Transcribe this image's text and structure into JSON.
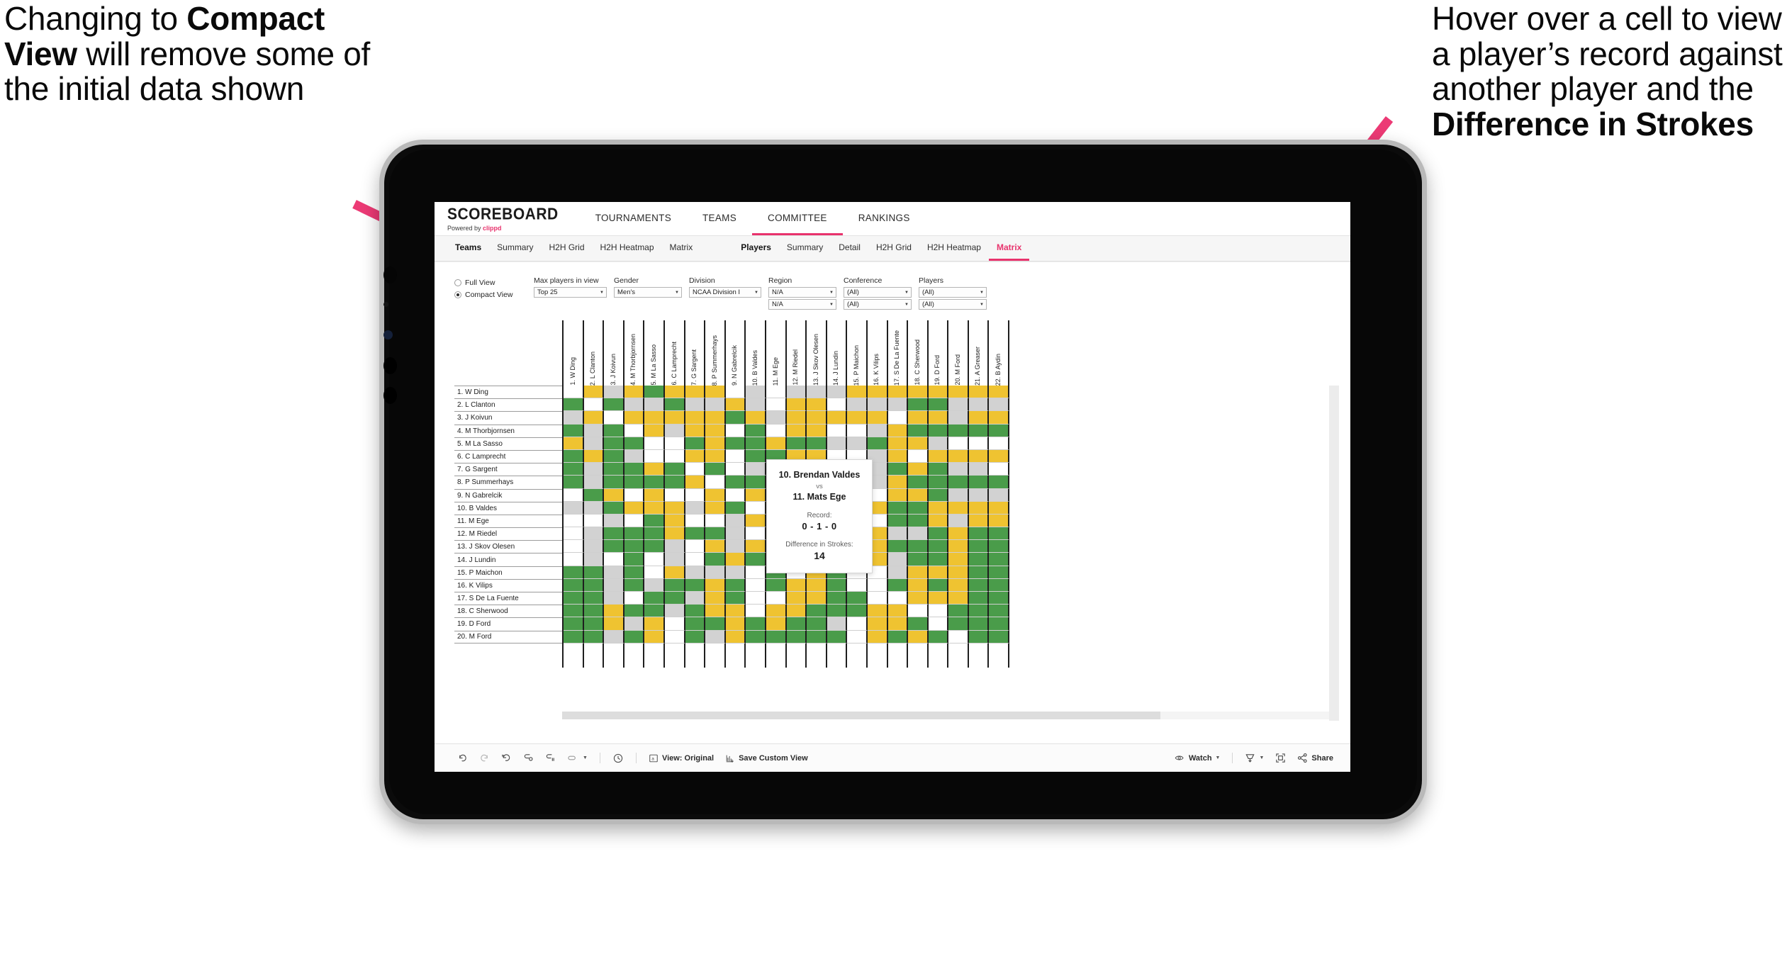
{
  "annotations": {
    "left": {
      "line1": "Changing to ",
      "bold1": "Compact View",
      "line2": " will remove some of the initial data shown"
    },
    "right": {
      "line1": "Hover over a cell to view a player’s record against another player and the ",
      "bold1": "Difference in Strokes"
    },
    "arrow_color": "#ec3a75"
  },
  "app": {
    "brand": {
      "name": "SCOREBOARD",
      "powered_prefix": "Powered by ",
      "powered_brand": "clippd"
    },
    "top_nav": [
      {
        "label": "TOURNAMENTS",
        "active": false
      },
      {
        "label": "TEAMS",
        "active": false
      },
      {
        "label": "COMMITTEE",
        "active": true
      },
      {
        "label": "RANKINGS",
        "active": false
      }
    ],
    "sub_tabs_teams": [
      {
        "label": "Teams",
        "group": true
      },
      {
        "label": "Summary",
        "active": false
      },
      {
        "label": "H2H Grid",
        "active": false
      },
      {
        "label": "H2H Heatmap",
        "active": false
      },
      {
        "label": "Matrix",
        "active": false
      }
    ],
    "sub_tabs_players": [
      {
        "label": "Players",
        "group": true
      },
      {
        "label": "Summary",
        "active": false
      },
      {
        "label": "Detail",
        "active": false
      },
      {
        "label": "H2H Grid",
        "active": false
      },
      {
        "label": "H2H Heatmap",
        "active": false
      },
      {
        "label": "Matrix",
        "active": true
      }
    ]
  },
  "filters": {
    "view_mode": {
      "options": [
        "Full View",
        "Compact View"
      ],
      "selected": "Compact View"
    },
    "selects": [
      {
        "label": "Max players in view",
        "value": "Top 25",
        "width_class": "w-mx"
      },
      {
        "label": "Gender",
        "value": "Men's",
        "width_class": "w-gd"
      },
      {
        "label": "Division",
        "value": "NCAA Division I",
        "width_class": "w-dv"
      },
      {
        "label": "Region",
        "value": "N/A",
        "value2": "N/A",
        "width_class": "w-rg"
      },
      {
        "label": "Conference",
        "value": "(All)",
        "value2": "(All)",
        "width_class": "w-cf"
      },
      {
        "label": "Players",
        "value": "(All)",
        "value2": "(All)",
        "width_class": "w-pl"
      }
    ]
  },
  "matrix": {
    "row_labels": [
      "1. W Ding",
      "2. L Clanton",
      "3. J Koivun",
      "4. M Thorbjornsen",
      "5. M La Sasso",
      "6. C Lamprecht",
      "7. G Sargent",
      "8. P Summerhays",
      "9. N Gabrelcik",
      "10. B Valdes",
      "11. M Ege",
      "12. M Riedel",
      "13. J Skov Olesen",
      "14. J Lundin",
      "15. P Maichon",
      "16. K Vilips",
      "17. S De La Fuente",
      "18. C Sherwood",
      "19. D Ford",
      "20. M Ford"
    ],
    "col_labels": [
      "1. W Ding",
      "2. L Clanton",
      "3. J Koivun",
      "4. M Thorbjornsen",
      "5. M La Sasso",
      "6. C Lamprecht",
      "7. G Sargent",
      "8. P Summerhays",
      "9. N Gabrelcik",
      "10. B Valdes",
      "11. M Ege",
      "12. M Riedel",
      "13. J Skov Olesen",
      "14. J Lundin",
      "15. P Maichon",
      "16. K Vilips",
      "17. S De La Fuente",
      "18. C Sherwood",
      "19. D Ford",
      "20. M Ford",
      "21. A Greaser",
      "22. B Aydin"
    ],
    "legend_colors": {
      "win": "#4a9c4a",
      "loss": "#efc331",
      "tie": "#d2d2d2",
      "none": "#ffffff"
    },
    "cells": [
      [
        "w",
        "y",
        "s",
        "y",
        "g",
        "y",
        "y",
        "y",
        "w",
        "s",
        "w",
        "s",
        "s",
        "s",
        "y",
        "y",
        "y",
        "y",
        "y",
        "y",
        "y",
        "y"
      ],
      [
        "g",
        "w",
        "g",
        "s",
        "s",
        "g",
        "s",
        "s",
        "y",
        "s",
        "w",
        "y",
        "y",
        "w",
        "s",
        "s",
        "s",
        "g",
        "g",
        "s",
        "s",
        "s"
      ],
      [
        "s",
        "y",
        "w",
        "y",
        "y",
        "y",
        "y",
        "y",
        "g",
        "y",
        "s",
        "y",
        "y",
        "y",
        "y",
        "y",
        "w",
        "y",
        "y",
        "s",
        "y",
        "y"
      ],
      [
        "g",
        "s",
        "g",
        "w",
        "y",
        "s",
        "y",
        "y",
        "w",
        "g",
        "w",
        "y",
        "y",
        "w",
        "w",
        "s",
        "y",
        "g",
        "g",
        "g",
        "g",
        "g"
      ],
      [
        "y",
        "s",
        "g",
        "g",
        "w",
        "w",
        "g",
        "y",
        "g",
        "g",
        "y",
        "g",
        "g",
        "s",
        "s",
        "g",
        "y",
        "y",
        "s",
        "w",
        "w",
        "w"
      ],
      [
        "g",
        "y",
        "g",
        "s",
        "w",
        "w",
        "y",
        "y",
        "w",
        "g",
        "g",
        "y",
        "y",
        "w",
        "w",
        "s",
        "y",
        "w",
        "y",
        "y",
        "y",
        "y"
      ],
      [
        "g",
        "s",
        "g",
        "g",
        "y",
        "g",
        "w",
        "g",
        "w",
        "s",
        "w",
        "y",
        "y",
        "g",
        "y",
        "s",
        "g",
        "y",
        "g",
        "s",
        "s",
        "w"
      ],
      [
        "g",
        "s",
        "g",
        "g",
        "g",
        "g",
        "y",
        "w",
        "g",
        "g",
        "w",
        "s",
        "s",
        "s",
        "g",
        "s",
        "y",
        "g",
        "g",
        "g",
        "g",
        "g"
      ],
      [
        "w",
        "g",
        "y",
        "w",
        "y",
        "w",
        "w",
        "y",
        "w",
        "y",
        "s",
        "w",
        "g",
        "y",
        "w",
        "w",
        "y",
        "y",
        "g",
        "s",
        "s",
        "s"
      ],
      [
        "s",
        "s",
        "g",
        "y",
        "y",
        "y",
        "s",
        "y",
        "g",
        "w",
        "g",
        "s",
        "y",
        "y",
        "s",
        "y",
        "g",
        "g",
        "y",
        "y",
        "y",
        "y"
      ],
      [
        "w",
        "w",
        "s",
        "w",
        "g",
        "y",
        "w",
        "w",
        "s",
        "y",
        "w",
        "s",
        "y",
        "s",
        "w",
        "w",
        "g",
        "g",
        "y",
        "s",
        "y",
        "y"
      ],
      [
        "w",
        "s",
        "g",
        "g",
        "g",
        "y",
        "g",
        "g",
        "s",
        "w",
        "s",
        "w",
        "g",
        "g",
        "g",
        "y",
        "s",
        "s",
        "g",
        "y",
        "g",
        "g"
      ],
      [
        "w",
        "s",
        "g",
        "g",
        "g",
        "s",
        "w",
        "y",
        "s",
        "y",
        "g",
        "w",
        "w",
        "y",
        "g",
        "y",
        "g",
        "g",
        "g",
        "y",
        "g",
        "g"
      ],
      [
        "w",
        "s",
        "w",
        "g",
        "w",
        "s",
        "w",
        "g",
        "y",
        "g",
        "g",
        "y",
        "w",
        "w",
        "g",
        "y",
        "s",
        "g",
        "g",
        "y",
        "g",
        "g"
      ],
      [
        "g",
        "g",
        "s",
        "g",
        "w",
        "y",
        "s",
        "s",
        "s",
        "w",
        "g",
        "w",
        "y",
        "g",
        "w",
        "w",
        "s",
        "y",
        "y",
        "y",
        "g",
        "g"
      ],
      [
        "g",
        "g",
        "s",
        "g",
        "s",
        "g",
        "g",
        "y",
        "g",
        "w",
        "g",
        "y",
        "y",
        "g",
        "w",
        "w",
        "g",
        "y",
        "g",
        "y",
        "g",
        "g"
      ],
      [
        "g",
        "g",
        "s",
        "w",
        "g",
        "g",
        "s",
        "y",
        "g",
        "w",
        "w",
        "y",
        "y",
        "g",
        "g",
        "w",
        "w",
        "y",
        "y",
        "y",
        "g",
        "g"
      ],
      [
        "g",
        "g",
        "y",
        "g",
        "g",
        "s",
        "g",
        "y",
        "y",
        "w",
        "y",
        "y",
        "g",
        "g",
        "g",
        "y",
        "y",
        "w",
        "w",
        "g",
        "g",
        "g"
      ],
      [
        "g",
        "g",
        "y",
        "s",
        "y",
        "w",
        "g",
        "g",
        "y",
        "g",
        "y",
        "g",
        "g",
        "s",
        "w",
        "y",
        "y",
        "g",
        "w",
        "g",
        "g",
        "g"
      ],
      [
        "g",
        "g",
        "s",
        "g",
        "y",
        "w",
        "g",
        "s",
        "y",
        "g",
        "g",
        "g",
        "g",
        "g",
        "w",
        "y",
        "g",
        "y",
        "g",
        "w",
        "g",
        "g"
      ]
    ]
  },
  "tooltip": {
    "player_a": "10. Brendan Valdes",
    "vs": "vs",
    "player_b": "11. Mats Ege",
    "record_label": "Record:",
    "record_value": "0 - 1 - 0",
    "difference_label": "Difference in Strokes:",
    "difference_value": "14"
  },
  "toolbar": {
    "items": [
      {
        "name": "undo-icon",
        "label": ""
      },
      {
        "name": "redo-icon",
        "label": ""
      },
      {
        "name": "revert-icon",
        "label": ""
      },
      {
        "name": "refresh-icon",
        "label": ""
      },
      {
        "name": "pause-icon",
        "label": ""
      },
      {
        "name": "filter-pill-icon",
        "label": ""
      }
    ],
    "clock_label": "",
    "view_label": "View: Original",
    "save_label": "Save Custom View",
    "watch_label": "Watch",
    "share_label": "Share"
  }
}
